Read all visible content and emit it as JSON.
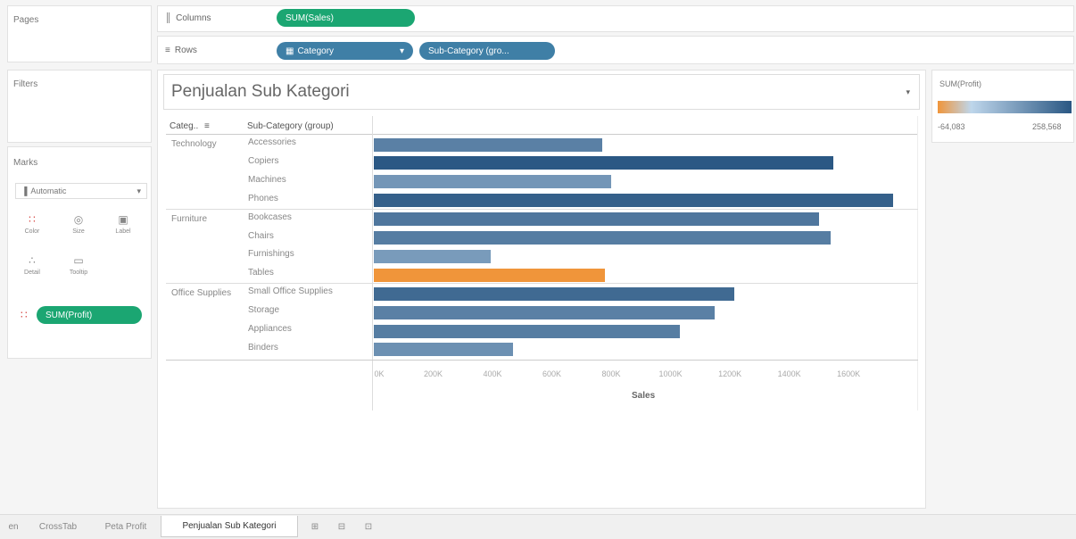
{
  "left": {
    "pages_label": "Pages",
    "filters_label": "Filters",
    "marks_label": "Marks",
    "mark_type": "Automatic",
    "mark_buttons": [
      "Color",
      "Size",
      "Label",
      "Detail",
      "Tooltip"
    ],
    "color_pill": "SUM(Profit)"
  },
  "shelves": {
    "columns_label": "Columns",
    "rows_label": "Rows",
    "columns_pill": "SUM(Sales)",
    "rows_pills": [
      "Category",
      "Sub-Category (gro..."
    ]
  },
  "sheet": {
    "title": "Penjualan Sub Kategori",
    "col_header_category": "Categ..",
    "col_header_subcategory": "Sub-Category (group)",
    "x_axis_title": "Sales"
  },
  "legend": {
    "title": "SUM(Profit)",
    "min_label": "-64,083",
    "max_label": "258,568",
    "color_low": "#f0953a",
    "color_high": "#2a5783"
  },
  "tabs": [
    "en",
    "CrossTab",
    "Peta Profit",
    "Penjualan Sub Kategori"
  ],
  "active_tab": "Penjualan Sub Kategori",
  "chart_data": {
    "type": "bar",
    "orientation": "horizontal",
    "xlabel": "Sales",
    "xlim": [
      0,
      1700000
    ],
    "x_ticks": [
      "0K",
      "200K",
      "400K",
      "600K",
      "800K",
      "1000K",
      "1200K",
      "1400K",
      "1600K"
    ],
    "groups": [
      {
        "category": "Technology",
        "items": [
          {
            "name": "Accessories",
            "sales": 770000,
            "profit": 130000
          },
          {
            "name": "Copiers",
            "sales": 1550000,
            "profit": 255000
          },
          {
            "name": "Machines",
            "sales": 800000,
            "profit": 60000
          },
          {
            "name": "Phones",
            "sales": 1750000,
            "profit": 230000
          }
        ]
      },
      {
        "category": "Furniture",
        "items": [
          {
            "name": "Bookcases",
            "sales": 1500000,
            "profit": 160000
          },
          {
            "name": "Chairs",
            "sales": 1540000,
            "profit": 140000
          },
          {
            "name": "Furnishings",
            "sales": 395000,
            "profit": 45000
          },
          {
            "name": "Tables",
            "sales": 780000,
            "profit": -64083
          }
        ]
      },
      {
        "category": "Office Supplies",
        "items": [
          {
            "name": "Small Office Supplies",
            "sales": 1215000,
            "profit": 200000
          },
          {
            "name": "Storage",
            "sales": 1150000,
            "profit": 130000
          },
          {
            "name": "Appliances",
            "sales": 1030000,
            "profit": 140000
          },
          {
            "name": "Binders",
            "sales": 470000,
            "profit": 80000
          }
        ]
      }
    ],
    "color_by": "SUM(Profit)",
    "color_range": [
      -64083,
      258568
    ],
    "grid": false
  }
}
